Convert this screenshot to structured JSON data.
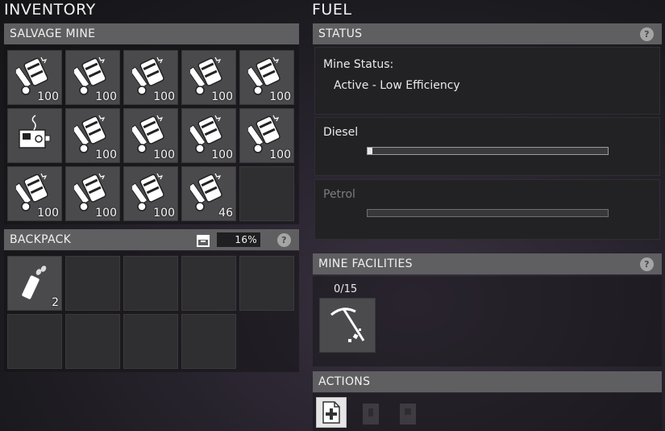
{
  "inventory": {
    "title": "INVENTORY",
    "salvage_mine": {
      "header": "SALVAGE MINE",
      "slots": [
        {
          "icon": "scrap-metal-icon",
          "qty": "100"
        },
        {
          "icon": "scrap-metal-icon",
          "qty": "100"
        },
        {
          "icon": "scrap-metal-icon",
          "qty": "100"
        },
        {
          "icon": "scrap-metal-icon",
          "qty": "100"
        },
        {
          "icon": "scrap-metal-icon",
          "qty": "100"
        },
        {
          "icon": "scrap-electronics-icon",
          "qty": ""
        },
        {
          "icon": "scrap-metal-icon",
          "qty": "100"
        },
        {
          "icon": "scrap-metal-icon",
          "qty": "100"
        },
        {
          "icon": "scrap-metal-icon",
          "qty": "100"
        },
        {
          "icon": "scrap-metal-icon",
          "qty": "100"
        },
        {
          "icon": "scrap-metal-icon",
          "qty": "100"
        },
        {
          "icon": "scrap-metal-icon",
          "qty": "100"
        },
        {
          "icon": "scrap-metal-icon",
          "qty": "100"
        },
        {
          "icon": "scrap-metal-icon",
          "qty": "46"
        },
        {
          "icon": "",
          "qty": ""
        }
      ]
    },
    "backpack": {
      "header": "BACKPACK",
      "capacity": "16%",
      "capacity_icon": "storage-box-icon",
      "slots": [
        {
          "icon": "ammo-clip-icon",
          "qty": "2"
        },
        {
          "icon": "",
          "qty": ""
        },
        {
          "icon": "",
          "qty": ""
        },
        {
          "icon": "",
          "qty": ""
        },
        {
          "icon": "",
          "qty": ""
        },
        {
          "icon": "",
          "qty": ""
        },
        {
          "icon": "",
          "qty": ""
        },
        {
          "icon": "",
          "qty": ""
        },
        {
          "icon": "",
          "qty": ""
        }
      ]
    }
  },
  "fuel": {
    "title": "FUEL",
    "status": {
      "header": "STATUS",
      "mine_status_label": "Mine Status:",
      "mine_status_value": "Active - Low Efficiency"
    },
    "diesel": {
      "label": "Diesel",
      "level": 0.02
    },
    "petrol": {
      "label": "Petrol",
      "level": 0.0
    }
  },
  "facilities": {
    "header": "MINE FACILITIES",
    "count": "0/15",
    "icon": "pickaxe-icon"
  },
  "actions": {
    "header": "ACTIONS",
    "buttons": [
      {
        "icon": "add-fuel-icon",
        "enabled": true
      },
      {
        "icon": "disabled-action-icon",
        "enabled": false
      },
      {
        "icon": "disabled-action-icon",
        "enabled": false
      }
    ]
  },
  "help_glyph": "?"
}
